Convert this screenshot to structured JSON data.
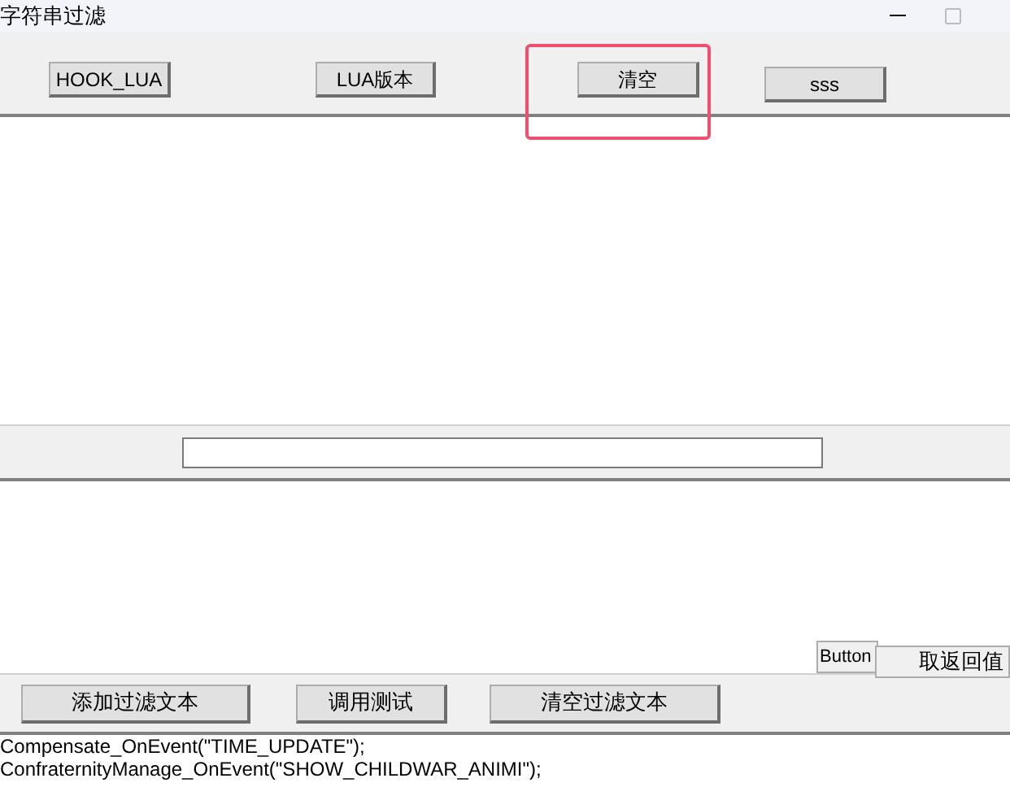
{
  "window": {
    "title": "字符串过滤"
  },
  "toolbar": {
    "buttons": [
      {
        "label": "HOOK_LUA",
        "highlighted": false
      },
      {
        "label": "LUA版本",
        "highlighted": false
      },
      {
        "label": "清空",
        "highlighted": true
      },
      {
        "label": "sss",
        "highlighted": false
      }
    ]
  },
  "side_buttons": [
    "Button",
    "取返回值"
  ],
  "bottom_buttons": [
    "添加过滤文本",
    "调用测试",
    "清空过滤文本"
  ],
  "log_lines": [
    "Compensate_OnEvent(\"TIME_UPDATE\");",
    "ConfraternityManage_OnEvent(\"SHOW_CHILDWAR_ANIMI\");"
  ]
}
